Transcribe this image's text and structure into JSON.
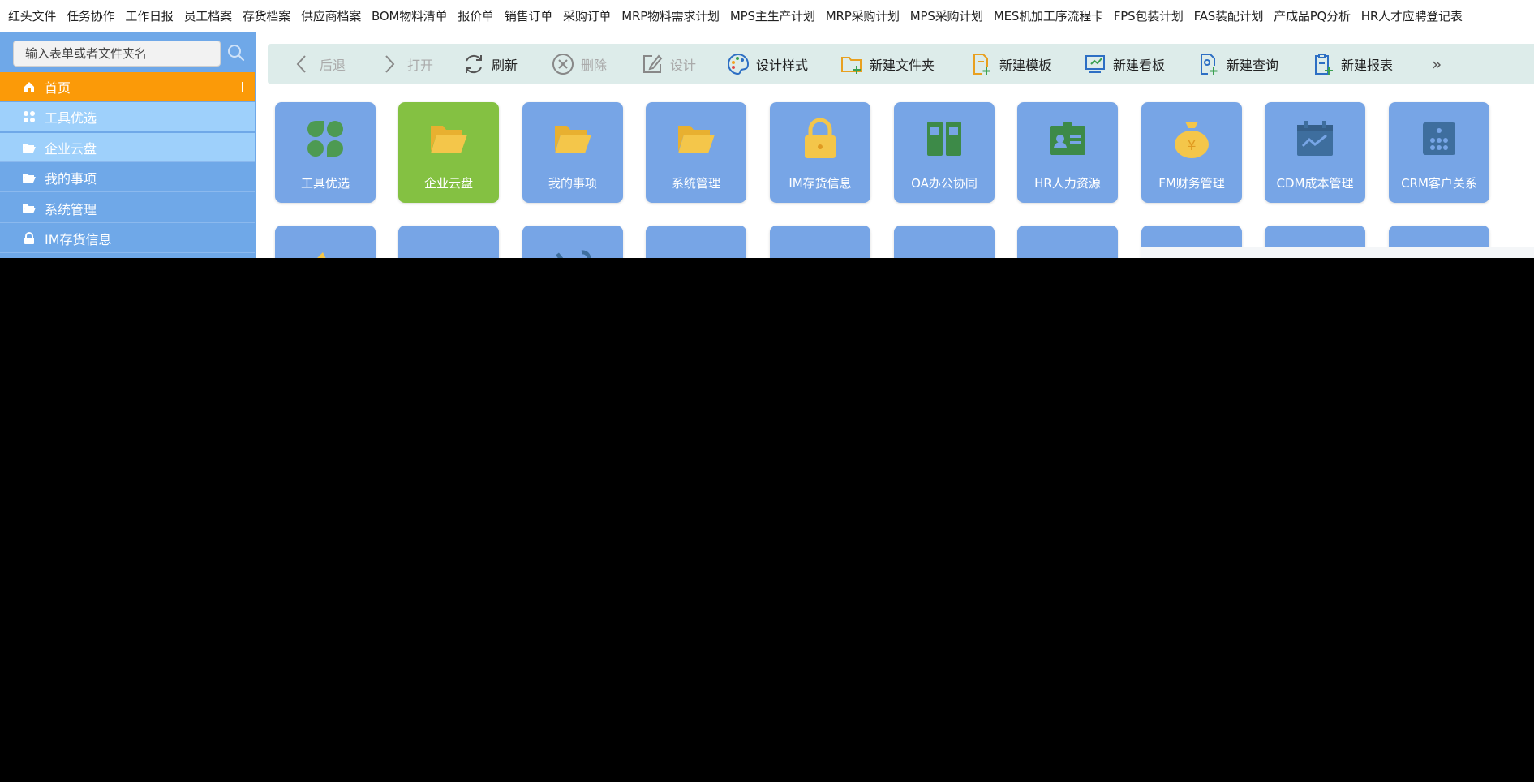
{
  "top_menu": [
    "红头文件",
    "任务协作",
    "工作日报",
    "员工档案",
    "存货档案",
    "供应商档案",
    "BOM物料清单",
    "报价单",
    "销售订单",
    "采购订单",
    "MRP物料需求计划",
    "MPS主生产计划",
    "MRP采购计划",
    "MPS采购计划",
    "MES机加工序流程卡",
    "FPS包装计划",
    "FAS装配计划",
    "产成品PQ分析",
    "HR人才应聘登记表"
  ],
  "sidebar": {
    "search_placeholder": "输入表单或者文件夹名",
    "items": [
      {
        "label": "首页",
        "icon": "home-icon"
      },
      {
        "label": "工具优选",
        "icon": "grid-icon"
      },
      {
        "label": "企业云盘",
        "icon": "folder-open-icon"
      },
      {
        "label": "我的事项",
        "icon": "folder-open-icon"
      },
      {
        "label": "系统管理",
        "icon": "folder-open-icon"
      },
      {
        "label": "IM存货信息",
        "icon": "lock-icon"
      }
    ]
  },
  "toolbar": {
    "back": "后退",
    "open": "打开",
    "refresh": "刷新",
    "delete": "删除",
    "design": "设计",
    "design_style": "设计样式",
    "new_folder": "新建文件夹",
    "new_template": "新建模板",
    "new_board": "新建看板",
    "new_query": "新建查询",
    "new_report": "新建报表",
    "more": "»"
  },
  "tiles": [
    {
      "label": "工具优选",
      "icon": "clover-icon"
    },
    {
      "label": "企业云盘",
      "icon": "folder-open-icon"
    },
    {
      "label": "我的事项",
      "icon": "folder-open-icon"
    },
    {
      "label": "系统管理",
      "icon": "folder-open-icon"
    },
    {
      "label": "IM存货信息",
      "icon": "lock-icon"
    },
    {
      "label": "OA办公协同",
      "icon": "binders-icon"
    },
    {
      "label": "HR人力资源",
      "icon": "id-card-icon"
    },
    {
      "label": "FM财务管理",
      "icon": "money-bag-icon"
    },
    {
      "label": "CDM成本管理",
      "icon": "calendar-chart-icon"
    },
    {
      "label": "CRM客户关系",
      "icon": "dice-icon"
    }
  ],
  "colors": {
    "sidebar_bg": "#6fa8e8",
    "active_item": "#fb9a08",
    "tile_blue": "#77a5e6",
    "tile_green": "#84c142",
    "toolbar_bg": "#ddecea",
    "icon_yellow": "#f4c64a",
    "icon_green": "#4d9a52"
  }
}
